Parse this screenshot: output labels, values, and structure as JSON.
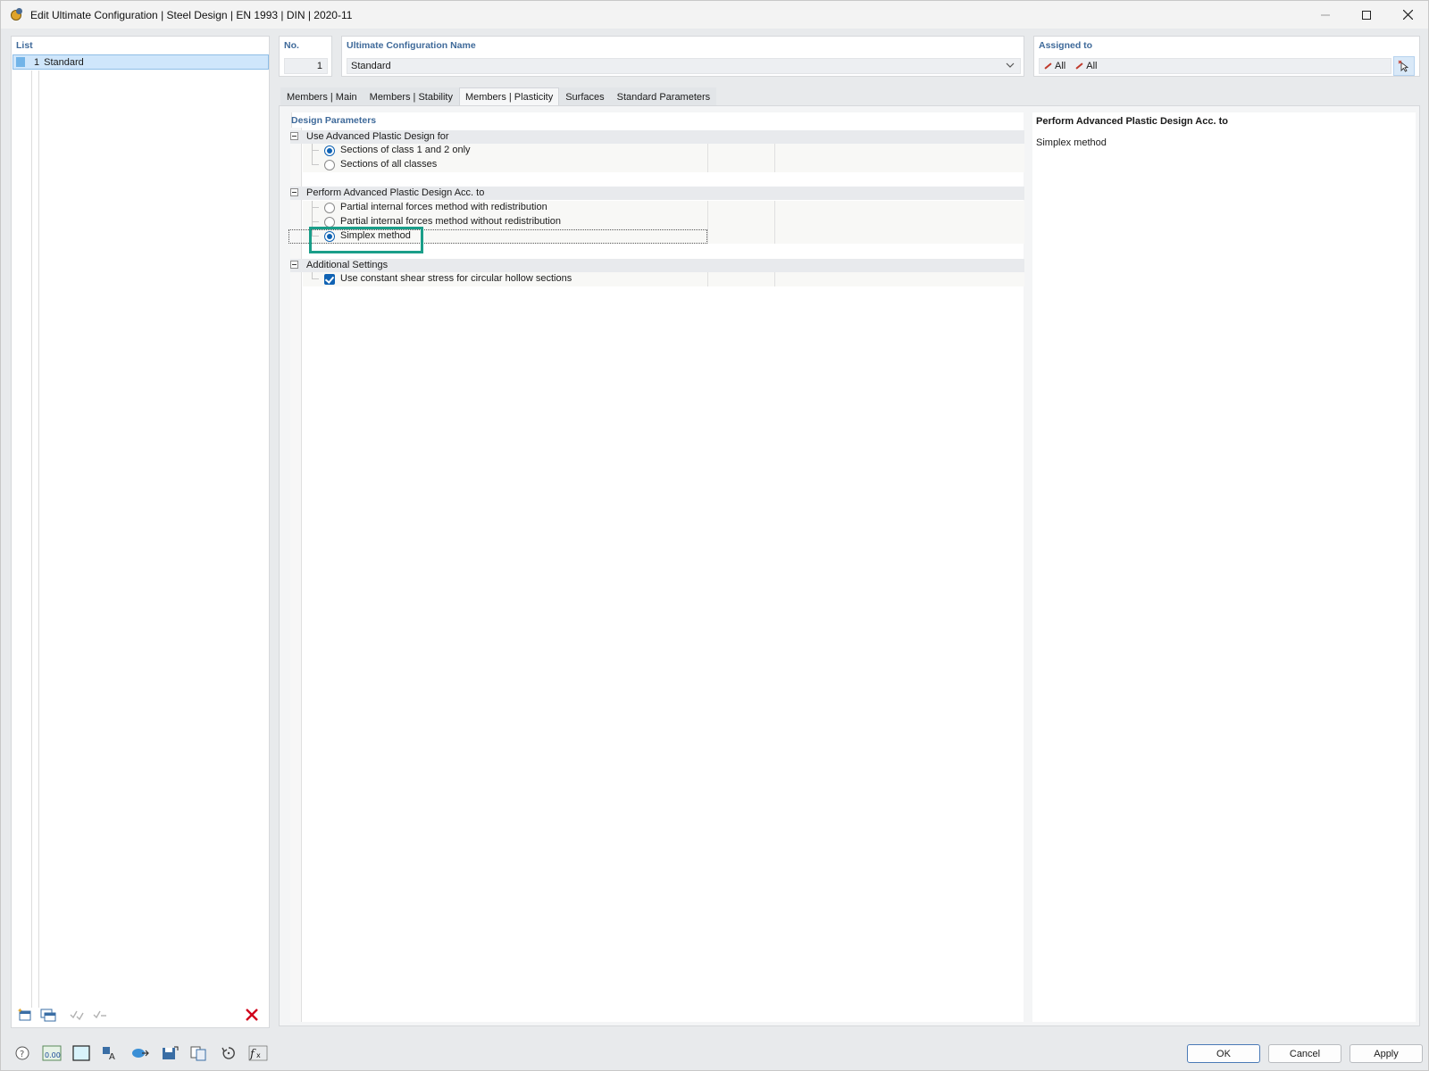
{
  "window": {
    "title": "Edit Ultimate Configuration | Steel Design | EN 1993 | DIN | 2020-11"
  },
  "list": {
    "header": "List",
    "items": [
      {
        "number": "1",
        "label": "Standard"
      }
    ]
  },
  "header": {
    "no_label": "No.",
    "no_value": "1",
    "name_label": "Ultimate Configuration Name",
    "name_value": "Standard",
    "assigned_label": "Assigned to",
    "assigned_items": [
      "All",
      "All"
    ]
  },
  "tabs": [
    {
      "label": "Members | Main",
      "active": false
    },
    {
      "label": "Members | Stability",
      "active": false
    },
    {
      "label": "Members | Plasticity",
      "active": true
    },
    {
      "label": "Surfaces",
      "active": false
    },
    {
      "label": "Standard Parameters",
      "active": false
    }
  ],
  "design_parameters": {
    "title": "Design Parameters",
    "groups": [
      {
        "label": "Use Advanced Plastic Design for",
        "options": [
          {
            "label": "Sections of class 1 and 2 only",
            "type": "radio",
            "selected": true
          },
          {
            "label": "Sections of all classes",
            "type": "radio",
            "selected": false
          }
        ]
      },
      {
        "label": "Perform Advanced Plastic Design Acc. to",
        "options": [
          {
            "label": "Partial internal forces method with redistribution",
            "type": "radio",
            "selected": false
          },
          {
            "label": "Partial internal forces method without redistribution",
            "type": "radio",
            "selected": false
          },
          {
            "label": "Simplex method",
            "type": "radio",
            "selected": true
          }
        ]
      },
      {
        "label": "Additional Settings",
        "options": [
          {
            "label": "Use constant shear stress for circular hollow sections",
            "type": "checkbox",
            "checked": true
          }
        ]
      }
    ]
  },
  "info_panel": {
    "title": "Perform Advanced Plastic Design Acc. to",
    "text": "Simplex method"
  },
  "buttons": {
    "ok": "OK",
    "cancel": "Cancel",
    "apply": "Apply"
  },
  "colors": {
    "accent": "#0f62b3",
    "header_text": "#3f6a9a",
    "highlight": "#1a9e89",
    "delete": "#d0021b"
  }
}
